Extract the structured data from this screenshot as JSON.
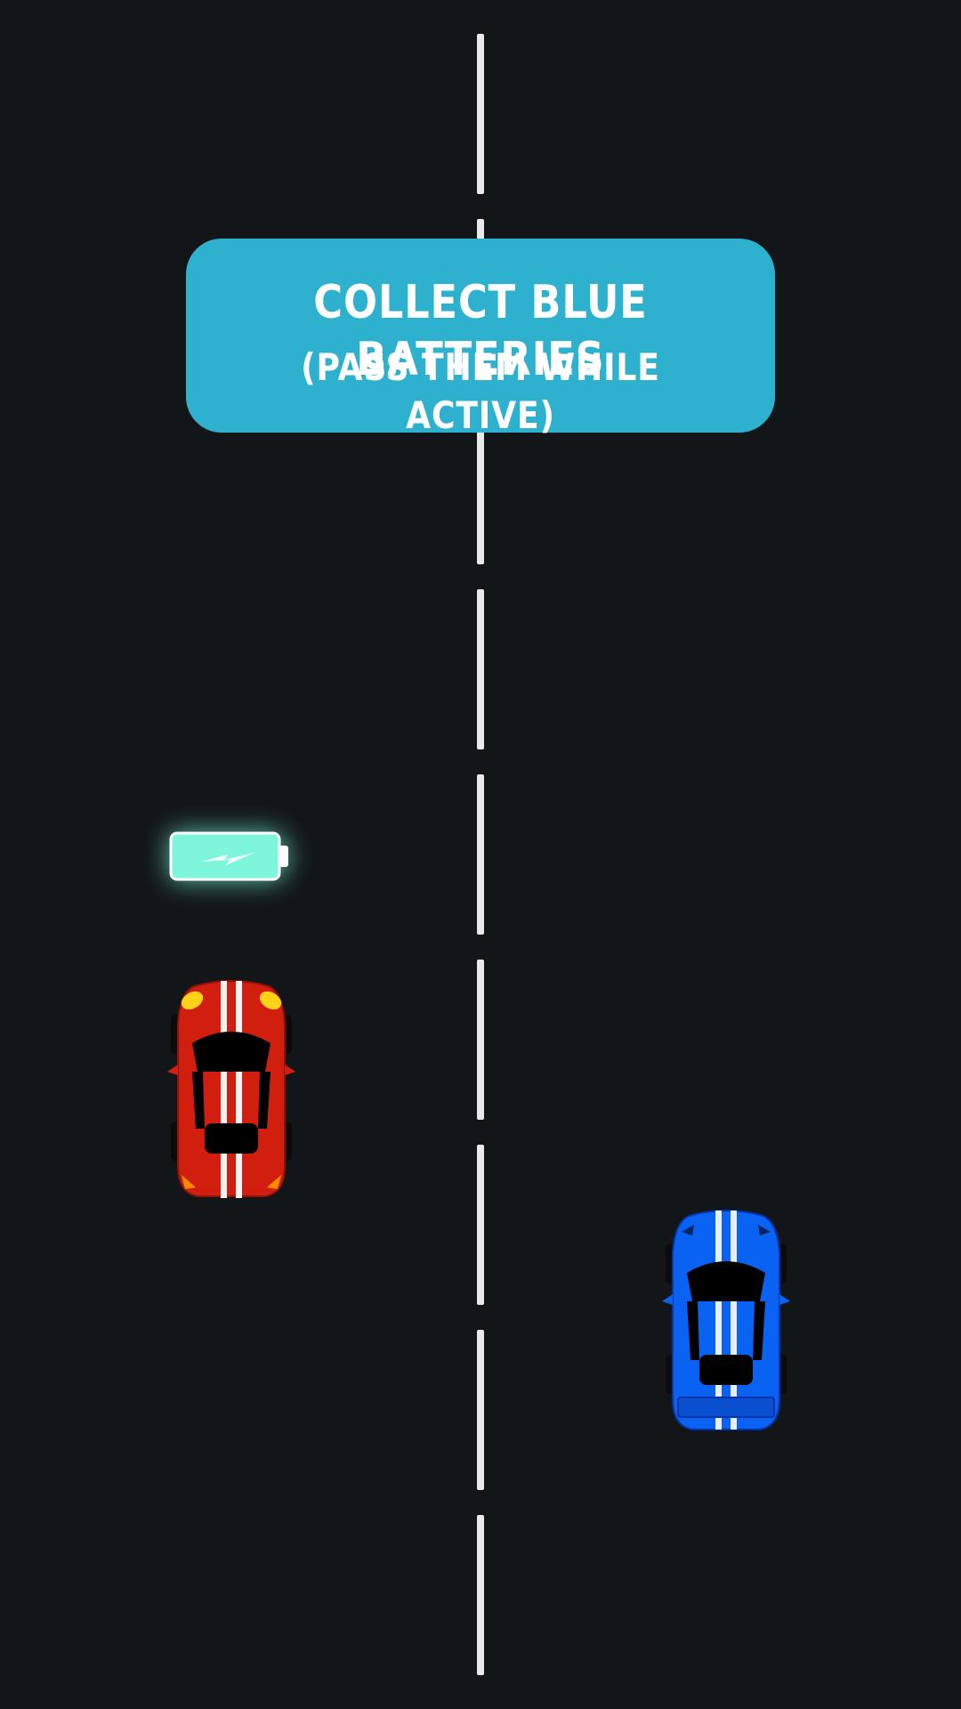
{
  "banner": {
    "line1": "COLLECT BLUE BATTERIES",
    "line2": "(PASS THEM WHILE ACTIVE)"
  },
  "colors": {
    "road": "#131619",
    "lane_marking": "#e9e9ea",
    "banner_background": "#2eb0cf",
    "banner_text": "#ffffff",
    "battery": "#7ff5dc",
    "red_car": "#d21e0e",
    "blue_car": "#0a62f2"
  },
  "sprites": {
    "battery": "battery-icon",
    "enemy_car": "red-sports-car",
    "player_car": "blue-sports-car"
  }
}
